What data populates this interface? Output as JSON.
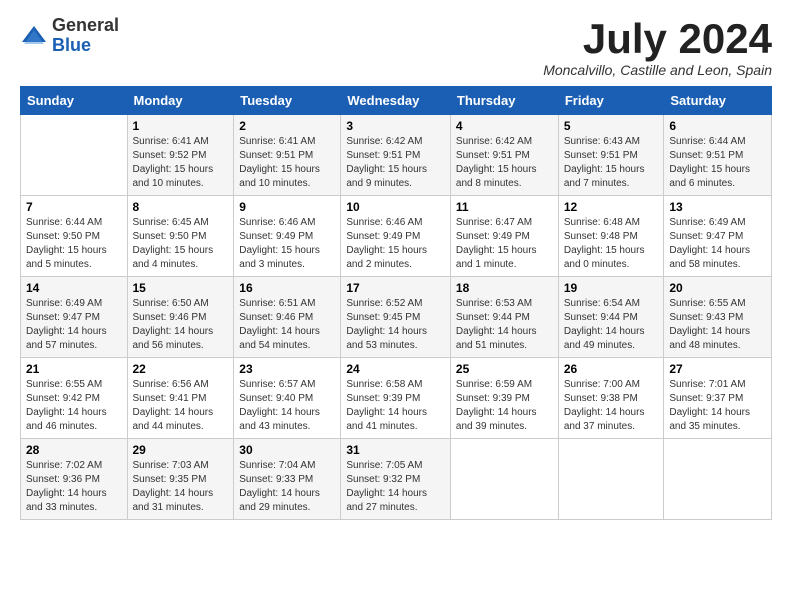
{
  "header": {
    "logo_general": "General",
    "logo_blue": "Blue",
    "month_title": "July 2024",
    "location": "Moncalvillo, Castille and Leon, Spain"
  },
  "weekdays": [
    "Sunday",
    "Monday",
    "Tuesday",
    "Wednesday",
    "Thursday",
    "Friday",
    "Saturday"
  ],
  "weeks": [
    [
      {
        "day": "",
        "info": ""
      },
      {
        "day": "1",
        "info": "Sunrise: 6:41 AM\nSunset: 9:52 PM\nDaylight: 15 hours\nand 10 minutes."
      },
      {
        "day": "2",
        "info": "Sunrise: 6:41 AM\nSunset: 9:51 PM\nDaylight: 15 hours\nand 10 minutes."
      },
      {
        "day": "3",
        "info": "Sunrise: 6:42 AM\nSunset: 9:51 PM\nDaylight: 15 hours\nand 9 minutes."
      },
      {
        "day": "4",
        "info": "Sunrise: 6:42 AM\nSunset: 9:51 PM\nDaylight: 15 hours\nand 8 minutes."
      },
      {
        "day": "5",
        "info": "Sunrise: 6:43 AM\nSunset: 9:51 PM\nDaylight: 15 hours\nand 7 minutes."
      },
      {
        "day": "6",
        "info": "Sunrise: 6:44 AM\nSunset: 9:51 PM\nDaylight: 15 hours\nand 6 minutes."
      }
    ],
    [
      {
        "day": "7",
        "info": "Sunrise: 6:44 AM\nSunset: 9:50 PM\nDaylight: 15 hours\nand 5 minutes."
      },
      {
        "day": "8",
        "info": "Sunrise: 6:45 AM\nSunset: 9:50 PM\nDaylight: 15 hours\nand 4 minutes."
      },
      {
        "day": "9",
        "info": "Sunrise: 6:46 AM\nSunset: 9:49 PM\nDaylight: 15 hours\nand 3 minutes."
      },
      {
        "day": "10",
        "info": "Sunrise: 6:46 AM\nSunset: 9:49 PM\nDaylight: 15 hours\nand 2 minutes."
      },
      {
        "day": "11",
        "info": "Sunrise: 6:47 AM\nSunset: 9:49 PM\nDaylight: 15 hours\nand 1 minute."
      },
      {
        "day": "12",
        "info": "Sunrise: 6:48 AM\nSunset: 9:48 PM\nDaylight: 15 hours\nand 0 minutes."
      },
      {
        "day": "13",
        "info": "Sunrise: 6:49 AM\nSunset: 9:47 PM\nDaylight: 14 hours\nand 58 minutes."
      }
    ],
    [
      {
        "day": "14",
        "info": "Sunrise: 6:49 AM\nSunset: 9:47 PM\nDaylight: 14 hours\nand 57 minutes."
      },
      {
        "day": "15",
        "info": "Sunrise: 6:50 AM\nSunset: 9:46 PM\nDaylight: 14 hours\nand 56 minutes."
      },
      {
        "day": "16",
        "info": "Sunrise: 6:51 AM\nSunset: 9:46 PM\nDaylight: 14 hours\nand 54 minutes."
      },
      {
        "day": "17",
        "info": "Sunrise: 6:52 AM\nSunset: 9:45 PM\nDaylight: 14 hours\nand 53 minutes."
      },
      {
        "day": "18",
        "info": "Sunrise: 6:53 AM\nSunset: 9:44 PM\nDaylight: 14 hours\nand 51 minutes."
      },
      {
        "day": "19",
        "info": "Sunrise: 6:54 AM\nSunset: 9:44 PM\nDaylight: 14 hours\nand 49 minutes."
      },
      {
        "day": "20",
        "info": "Sunrise: 6:55 AM\nSunset: 9:43 PM\nDaylight: 14 hours\nand 48 minutes."
      }
    ],
    [
      {
        "day": "21",
        "info": "Sunrise: 6:55 AM\nSunset: 9:42 PM\nDaylight: 14 hours\nand 46 minutes."
      },
      {
        "day": "22",
        "info": "Sunrise: 6:56 AM\nSunset: 9:41 PM\nDaylight: 14 hours\nand 44 minutes."
      },
      {
        "day": "23",
        "info": "Sunrise: 6:57 AM\nSunset: 9:40 PM\nDaylight: 14 hours\nand 43 minutes."
      },
      {
        "day": "24",
        "info": "Sunrise: 6:58 AM\nSunset: 9:39 PM\nDaylight: 14 hours\nand 41 minutes."
      },
      {
        "day": "25",
        "info": "Sunrise: 6:59 AM\nSunset: 9:39 PM\nDaylight: 14 hours\nand 39 minutes."
      },
      {
        "day": "26",
        "info": "Sunrise: 7:00 AM\nSunset: 9:38 PM\nDaylight: 14 hours\nand 37 minutes."
      },
      {
        "day": "27",
        "info": "Sunrise: 7:01 AM\nSunset: 9:37 PM\nDaylight: 14 hours\nand 35 minutes."
      }
    ],
    [
      {
        "day": "28",
        "info": "Sunrise: 7:02 AM\nSunset: 9:36 PM\nDaylight: 14 hours\nand 33 minutes."
      },
      {
        "day": "29",
        "info": "Sunrise: 7:03 AM\nSunset: 9:35 PM\nDaylight: 14 hours\nand 31 minutes."
      },
      {
        "day": "30",
        "info": "Sunrise: 7:04 AM\nSunset: 9:33 PM\nDaylight: 14 hours\nand 29 minutes."
      },
      {
        "day": "31",
        "info": "Sunrise: 7:05 AM\nSunset: 9:32 PM\nDaylight: 14 hours\nand 27 minutes."
      },
      {
        "day": "",
        "info": ""
      },
      {
        "day": "",
        "info": ""
      },
      {
        "day": "",
        "info": ""
      }
    ]
  ]
}
